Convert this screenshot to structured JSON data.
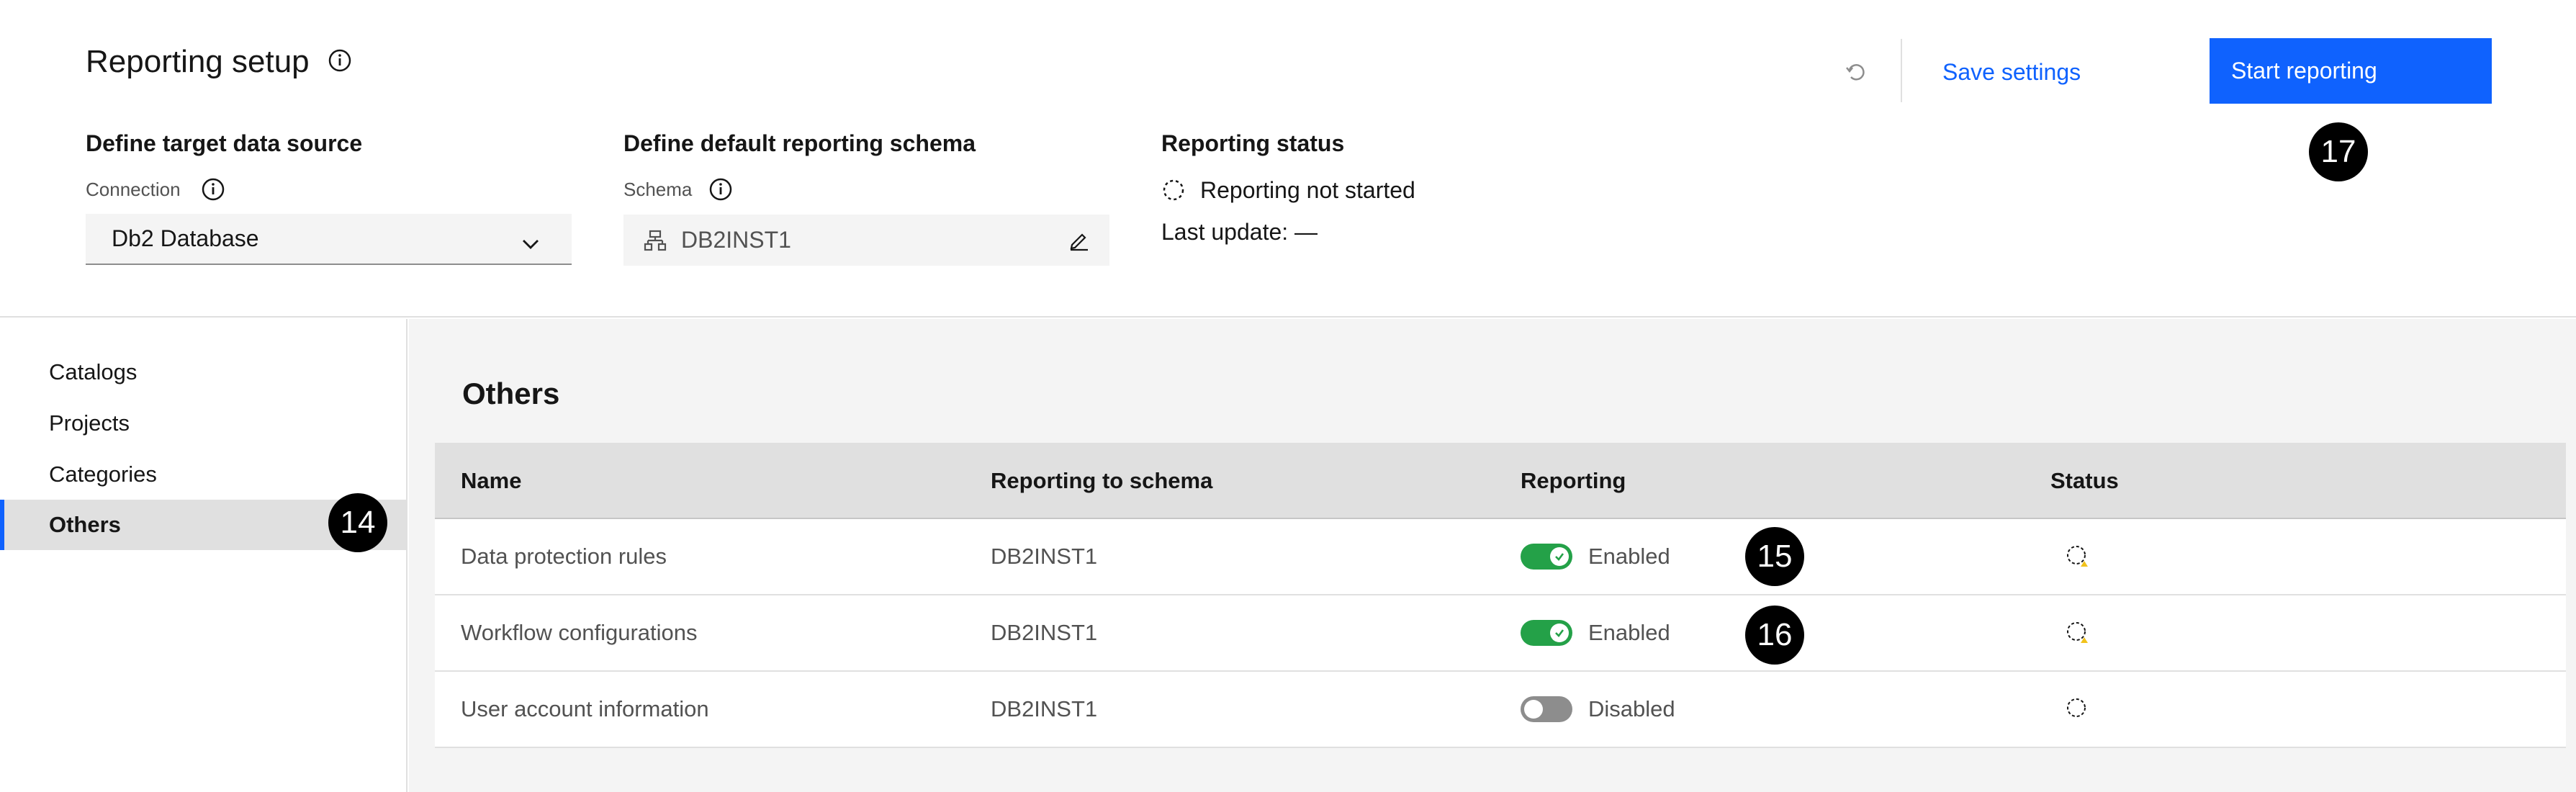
{
  "header": {
    "title": "Reporting setup",
    "save_label": "Save settings",
    "start_label": "Start reporting"
  },
  "target": {
    "section_title": "Define target data source",
    "connection_label": "Connection",
    "connection_value": "Db2 Database"
  },
  "schema": {
    "section_title": "Define default reporting schema",
    "schema_label": "Schema",
    "schema_value": "DB2INST1"
  },
  "status": {
    "section_title": "Reporting status",
    "status_text": "Reporting not started",
    "last_update": "Last update: —"
  },
  "sidebar": {
    "items": [
      {
        "label": "Catalogs"
      },
      {
        "label": "Projects"
      },
      {
        "label": "Categories"
      },
      {
        "label": "Others"
      }
    ]
  },
  "main": {
    "title": "Others",
    "columns": [
      "Name",
      "Reporting to schema",
      "Reporting",
      "Status"
    ],
    "rows": [
      {
        "name": "Data protection rules",
        "schema": "DB2INST1",
        "reporting": "Enabled"
      },
      {
        "name": "Workflow configurations",
        "schema": "DB2INST1",
        "reporting": "Enabled"
      },
      {
        "name": "User account information",
        "schema": "DB2INST1",
        "reporting": "Disabled"
      }
    ]
  },
  "markers": [
    "17",
    "14",
    "15",
    "16"
  ],
  "colors": {
    "accent": "#0f62fe",
    "toggle_on": "#24a148",
    "toggle_off": "#8d8d8d",
    "warning": "#f1c21b"
  }
}
